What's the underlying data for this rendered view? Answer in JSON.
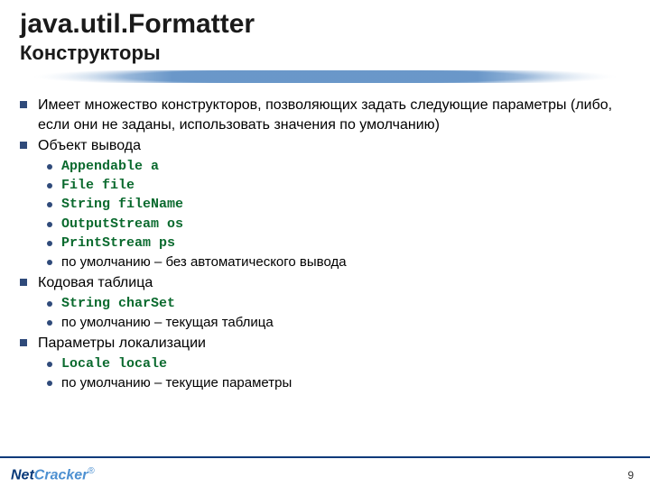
{
  "title": "java.util.Formatter",
  "subtitle": "Конструкторы",
  "bullets": {
    "b0": "Имеет множество конструкторов, позволяющих задать следующие параметры (либо, если они не заданы, использовать значения по умолчанию)",
    "b1": "Объект вывода",
    "b1_0": "Appendable a",
    "b1_1": "File file",
    "b1_2": "String fileName",
    "b1_3": "OutputStream os",
    "b1_4": "PrintStream ps",
    "b1_5": "по умолчанию – без автоматического вывода",
    "b2": "Кодовая таблица",
    "b2_0": "String charSet",
    "b2_1": "по умолчанию – текущая таблица",
    "b3": "Параметры локализации",
    "b3_0": "Locale locale",
    "b3_1": "по умолчанию – текущие параметры"
  },
  "logo": {
    "part1": "Net",
    "part2": "Cracker",
    "reg": "®"
  },
  "page_number": "9"
}
